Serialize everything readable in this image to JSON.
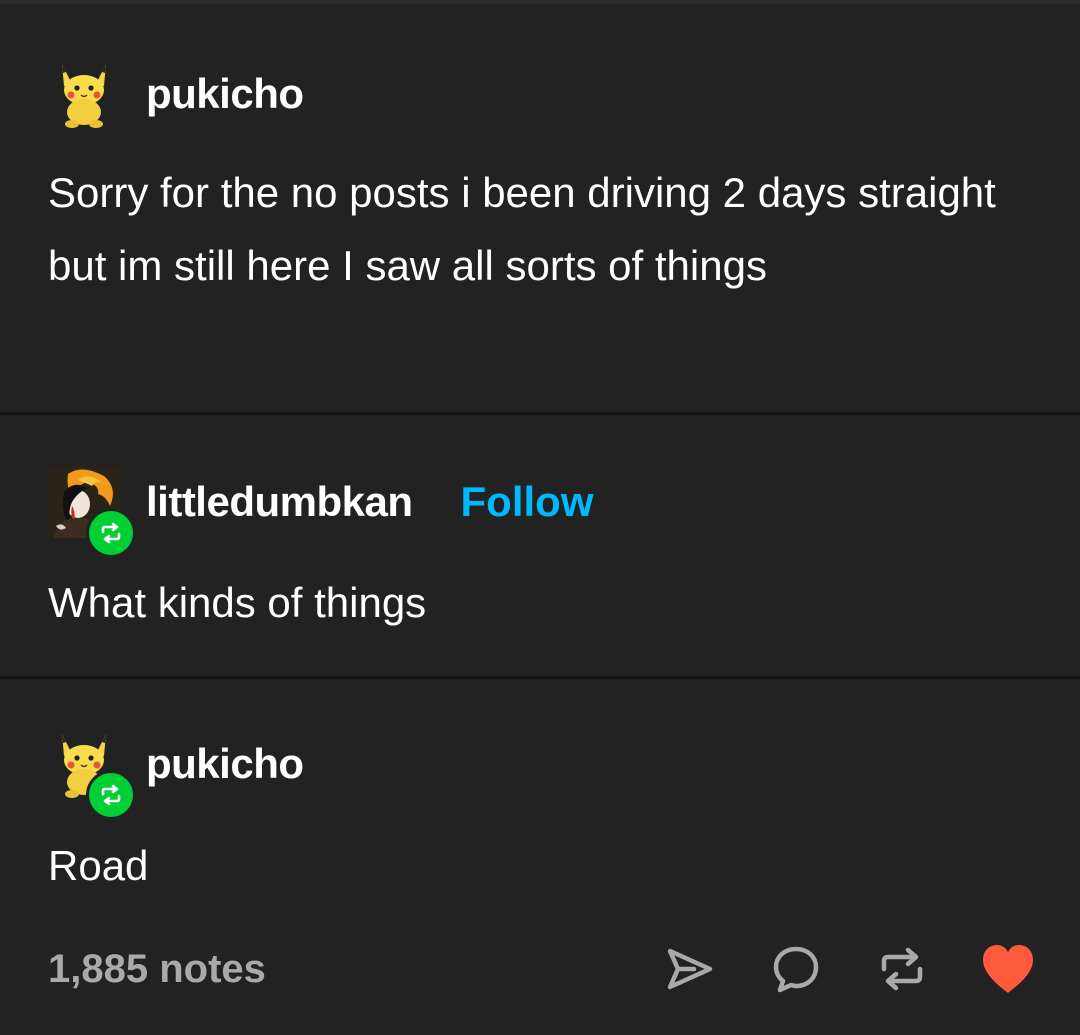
{
  "post": {
    "original": {
      "username": "pukicho",
      "avatar_icon": "pikachu-plush-avatar",
      "text": "Sorry for the no posts i been driving 2 days straight but im still here I saw all sorts of things"
    },
    "reply1": {
      "username": "littledumbkan",
      "follow_label": "Follow",
      "avatar_icon": "anime-character-avatar",
      "badge_icon": "reblog-icon",
      "text": "What kinds of things"
    },
    "reply2": {
      "username": "pukicho",
      "avatar_icon": "pikachu-plush-avatar",
      "badge_icon": "reblog-icon",
      "text": "Road"
    },
    "footer": {
      "notes": "1,885 notes",
      "actions": [
        "share-icon",
        "reply-icon",
        "reblog-icon",
        "like-heart-icon"
      ]
    }
  },
  "colors": {
    "background": "#222222",
    "text": "#ffffff",
    "follow": "#00b8ff",
    "reblog_badge": "#00cf35",
    "like": "#ff5a3c",
    "muted": "#a9a9a9"
  }
}
